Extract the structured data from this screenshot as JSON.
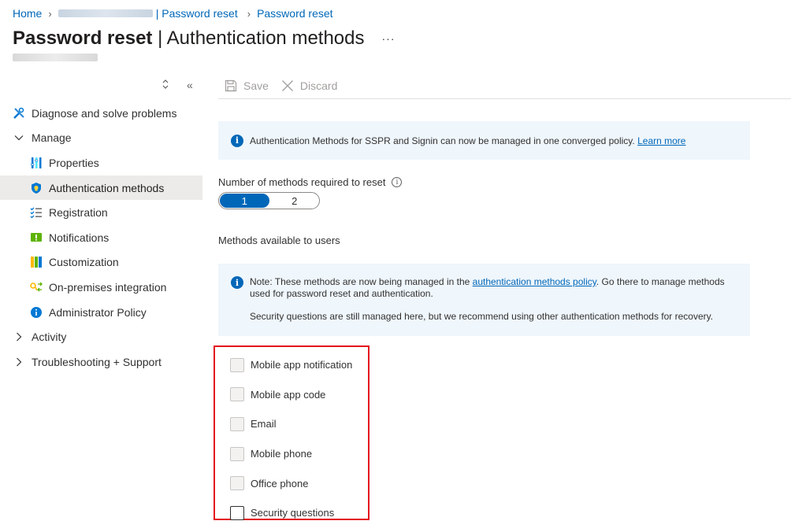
{
  "breadcrumb": {
    "home": "Home",
    "tenant_suffix": "| Password reset",
    "current": "Password reset"
  },
  "page": {
    "title_bold": "Password reset",
    "title_rest": "| Authentication methods",
    "more": "···"
  },
  "sidebar": {
    "items": [
      {
        "label": "Diagnose and solve problems",
        "icon": "wrench-icon"
      },
      {
        "label": "Manage",
        "icon": "chevron-down-icon"
      },
      {
        "label": "Properties",
        "icon": "properties-icon"
      },
      {
        "label": "Authentication methods",
        "icon": "shield-icon"
      },
      {
        "label": "Registration",
        "icon": "checklist-icon"
      },
      {
        "label": "Notifications",
        "icon": "notification-icon"
      },
      {
        "label": "Customization",
        "icon": "customization-icon"
      },
      {
        "label": "On-premises integration",
        "icon": "key-icon"
      },
      {
        "label": "Administrator Policy",
        "icon": "info-icon"
      },
      {
        "label": "Activity",
        "icon": "chevron-right-icon"
      },
      {
        "label": "Troubleshooting + Support",
        "icon": "chevron-right-icon"
      }
    ]
  },
  "toolbar": {
    "save_label": "Save",
    "discard_label": "Discard"
  },
  "banner": {
    "text": "Authentication Methods for SSPR and Signin can now be managed in one converged policy.",
    "link": "Learn more"
  },
  "methods_required": {
    "label": "Number of methods required to reset",
    "options": [
      "1",
      "2"
    ],
    "selected": "1"
  },
  "available": {
    "label": "Methods available to users"
  },
  "note": {
    "text_before": "Note: These methods are now being managed in the",
    "link": "authentication methods policy",
    "text_after": ". Go there to manage methods used for password reset and authentication.",
    "text2": "Security questions are still managed here, but we recommend using other authentication methods for recovery."
  },
  "methods": [
    {
      "label": "Mobile app notification",
      "enabled": false
    },
    {
      "label": "Mobile app code",
      "enabled": false
    },
    {
      "label": "Email",
      "enabled": false
    },
    {
      "label": "Mobile phone",
      "enabled": false
    },
    {
      "label": "Office phone",
      "enabled": false
    },
    {
      "label": "Security questions",
      "enabled": true
    }
  ],
  "colors": {
    "accent": "#0067b8",
    "highlight": "#e3101e",
    "info_bg": "#eff6fc",
    "active_nav_bg": "#edebe9"
  }
}
